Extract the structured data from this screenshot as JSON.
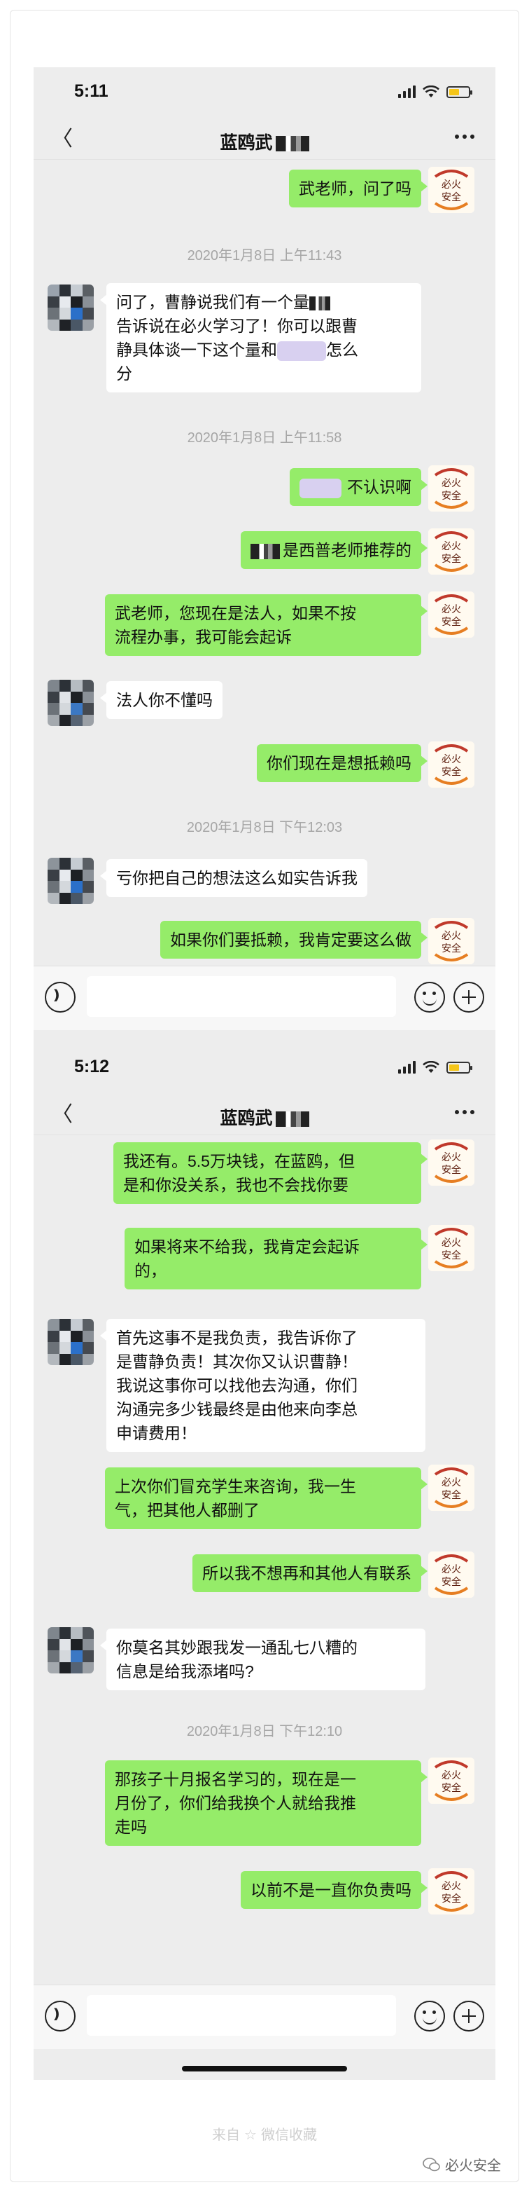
{
  "screens": [
    {
      "time": "5:11",
      "title": "蓝鸥武",
      "messages": [
        {
          "kind": "me",
          "text": "武老师，问了吗"
        },
        {
          "kind": "time",
          "text": "2020年1月8日 上午11:43"
        },
        {
          "kind": "other",
          "lines": [
            "问了，曹静说我们有一个量",
            "告诉说在必火学习了！你可以跟曹",
            "静具体谈一下这个量和",
            "分"
          ],
          "tail_3": "怎么"
        },
        {
          "kind": "time",
          "text": "2020年1月8日 上午11:58"
        },
        {
          "kind": "me",
          "text": "不认识啊"
        },
        {
          "kind": "me",
          "text": "是西普老师推荐的"
        },
        {
          "kind": "me",
          "lines": [
            "武老师，您现在是法人，如果不按",
            "流程办事，我可能会起诉"
          ]
        },
        {
          "kind": "other",
          "text": "法人你不懂吗"
        },
        {
          "kind": "me",
          "text": "你们现在是想抵赖吗"
        },
        {
          "kind": "time",
          "text": "2020年1月8日 下午12:03"
        },
        {
          "kind": "other",
          "text": "亏你把自己的想法这么如实告诉我"
        },
        {
          "kind": "me",
          "text": "如果你们要抵赖，我肯定要这么做"
        }
      ]
    },
    {
      "time": "5:12",
      "title": "蓝鸥武",
      "messages": [
        {
          "kind": "me",
          "lines": [
            "我还有。5.5万块钱，在蓝鸥，但",
            "是和你没关系，我也不会找你要"
          ]
        },
        {
          "kind": "me",
          "lines": [
            "如果将来不给我，我肯定会起诉",
            "的，"
          ]
        },
        {
          "kind": "other",
          "lines": [
            "首先这事不是我负责，我告诉你了",
            "是曹静负责！其次你又认识曹静！",
            "我说这事你可以找他去沟通，你们",
            "沟通完多少钱最终是由他来向李总",
            "申请费用！"
          ]
        },
        {
          "kind": "me",
          "lines": [
            "上次你们冒充学生来咨询，我一生",
            "气，把其他人都删了"
          ]
        },
        {
          "kind": "me",
          "text": "所以我不想再和其他人有联系"
        },
        {
          "kind": "other",
          "lines": [
            "你莫名其妙跟我发一通乱七八糟的",
            "信息是给我添堵吗?"
          ]
        },
        {
          "kind": "time",
          "text": "2020年1月8日 下午12:10"
        },
        {
          "kind": "me",
          "lines": [
            "那孩子十月报名学习的，现在是一",
            "月份了，你们给我换个人就给我推",
            "走吗"
          ]
        },
        {
          "kind": "me",
          "text": "以前不是一直你负责吗"
        }
      ]
    }
  ],
  "avatar_me_text": "必火\n安全",
  "footer": {
    "from": "来自",
    "source": "微信收藏"
  },
  "watermark": "必火安全",
  "colors": {
    "my_bubble": "#95ec69",
    "other_bubble": "#ffffff",
    "background": "#ededed",
    "timestamp": "#a6a6a6"
  }
}
